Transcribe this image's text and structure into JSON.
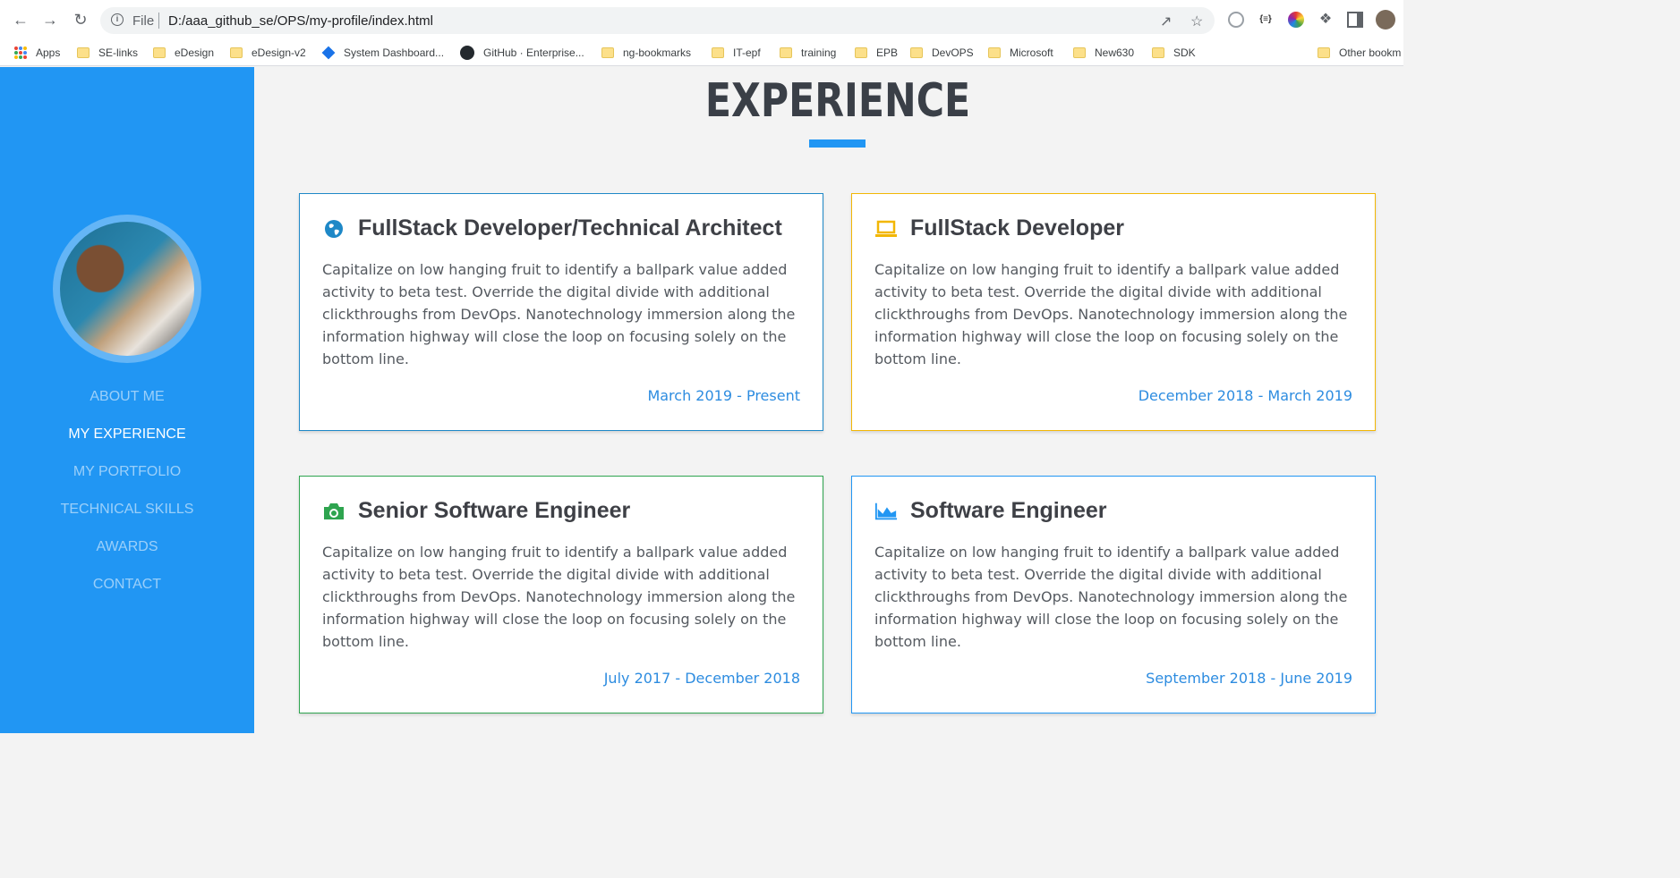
{
  "browser": {
    "omnibox": {
      "scheme_label": "File",
      "url": "D:/aaa_github_se/OPS/my-profile/index.html"
    },
    "bookmarks": [
      {
        "label": "Apps",
        "kind": "apps"
      },
      {
        "label": "SE-links",
        "kind": "folder"
      },
      {
        "label": "eDesign",
        "kind": "folder"
      },
      {
        "label": "eDesign-v2",
        "kind": "folder"
      },
      {
        "label": "System Dashboard...",
        "kind": "site"
      },
      {
        "label": "GitHub · Enterprise...",
        "kind": "site"
      },
      {
        "label": "ng-bookmarks",
        "kind": "folder"
      },
      {
        "label": "IT-epf",
        "kind": "folder"
      },
      {
        "label": "training",
        "kind": "folder"
      },
      {
        "label": "EPB",
        "kind": "folder"
      },
      {
        "label": "DevOPS",
        "kind": "folder"
      },
      {
        "label": "Microsoft",
        "kind": "folder"
      },
      {
        "label": "New630",
        "kind": "folder"
      },
      {
        "label": "SDK",
        "kind": "folder"
      },
      {
        "label": "Other bookm",
        "kind": "folder"
      }
    ]
  },
  "sidebar": {
    "nav": [
      {
        "label": "ABOUT ME",
        "active": false
      },
      {
        "label": "MY EXPERIENCE",
        "active": true
      },
      {
        "label": "MY PORTFOLIO",
        "active": false
      },
      {
        "label": "TECHNICAL SKILLS",
        "active": false
      },
      {
        "label": "AWARDS",
        "active": false
      },
      {
        "label": "CONTACT",
        "active": false
      }
    ]
  },
  "main": {
    "title": "EXPERIENCE",
    "accent": "#2196f3",
    "cards": [
      {
        "icon": "globe-icon",
        "color": "#1e88c7",
        "title": "FullStack Developer/Technical Architect",
        "body": "Capitalize on low hanging fruit to identify a ballpark value added activity to beta test. Override the digital divide with additional clickthroughs from DevOps. Nanotechnology immersion along the information highway will close the loop on focusing solely on the bottom line.",
        "date": "March 2019 - Present"
      },
      {
        "icon": "laptop-icon",
        "color": "#f2b705",
        "title": "FullStack Developer",
        "body": "Capitalize on low hanging fruit to identify a ballpark value added activity to beta test. Override the digital divide with additional clickthroughs from DevOps. Nanotechnology immersion along the information highway will close the loop on focusing solely on the bottom line.",
        "date": "December 2018 - March 2019"
      },
      {
        "icon": "camera-icon",
        "color": "#2ea44f",
        "title": "Senior Software Engineer",
        "body": "Capitalize on low hanging fruit to identify a ballpark value added activity to beta test. Override the digital divide with additional clickthroughs from DevOps. Nanotechnology immersion along the information highway will close the loop on focusing solely on the bottom line.",
        "date": "July 2017 - December 2018"
      },
      {
        "icon": "area-chart-icon",
        "color": "#2196f3",
        "title": "Software Engineer",
        "body": "Capitalize on low hanging fruit to identify a ballpark value added activity to beta test. Override the digital divide with additional clickthroughs from DevOps. Nanotechnology immersion along the information highway will close the loop on focusing solely on the bottom line.",
        "date": "September 2018 - June 2019"
      }
    ]
  }
}
